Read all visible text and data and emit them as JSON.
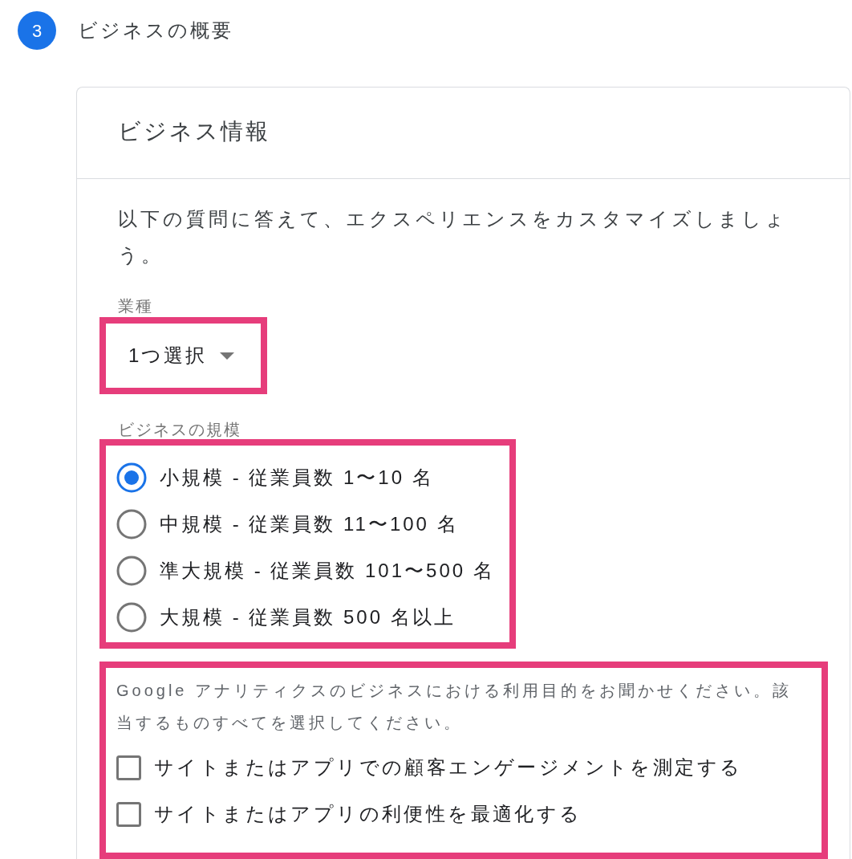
{
  "step": {
    "number": "3",
    "title": "ビジネスの概要"
  },
  "card": {
    "title": "ビジネス情報",
    "description": "以下の質問に答えて、エクスペリエンスをカスタマイズしましょう。",
    "sections": [
      {
        "kind": "dropdown",
        "label": "業種",
        "highlighted": true,
        "value": "1つ選択"
      },
      {
        "kind": "radio",
        "label": "ビジネスの規模",
        "highlighted": true,
        "options": [
          {
            "label": "小規模 - 従業員数 1〜10 名",
            "selected": true
          },
          {
            "label": "中規模 - 従業員数 11〜100 名",
            "selected": false
          },
          {
            "label": "準大規模 - 従業員数 101〜500 名",
            "selected": false
          },
          {
            "label": "大規模 - 従業員数 500 名以上",
            "selected": false
          }
        ]
      },
      {
        "kind": "checkbox",
        "label": "Google アナリティクスのビジネスにおける利用目的をお聞かせください。該当するものすべてを選択してください。",
        "highlighted": true,
        "options": [
          {
            "label": "サイトまたはアプリでの顧客エンゲージメントを測定する",
            "checked": false
          },
          {
            "label": "サイトまたはアプリの利便性を最適化する",
            "checked": false
          }
        ]
      }
    ]
  }
}
